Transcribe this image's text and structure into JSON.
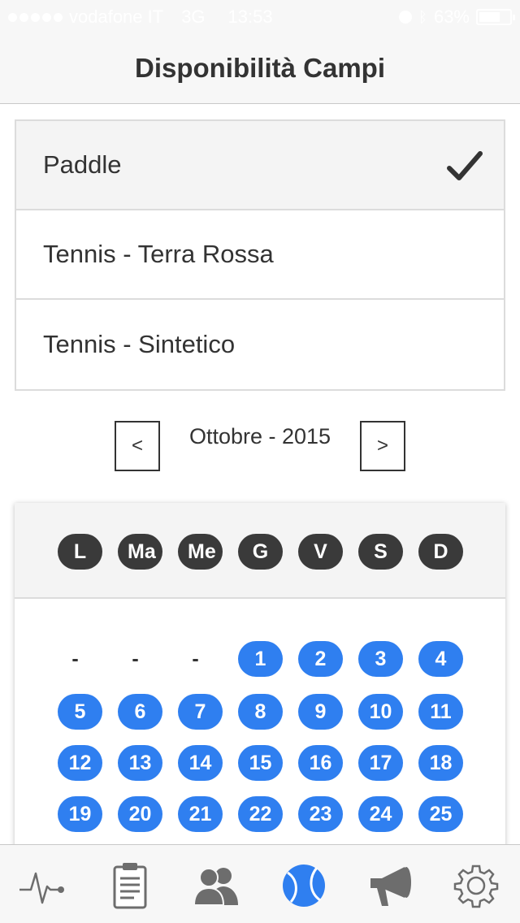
{
  "status_bar": {
    "carrier": "vodafone IT",
    "network": "3G",
    "time": "13:53",
    "battery_percent": "63%",
    "battery_level": 0.63
  },
  "nav": {
    "title": "Disponibilità Campi"
  },
  "sports": {
    "items": [
      {
        "label": "Paddle",
        "selected": true
      },
      {
        "label": "Tennis - Terra Rossa",
        "selected": false
      },
      {
        "label": "Tennis - Sintetico",
        "selected": false
      }
    ]
  },
  "month_nav": {
    "prev_label": "<",
    "next_label": ">",
    "month_label": "Ottobre - 2015"
  },
  "calendar": {
    "weekdays": [
      "L",
      "Ma",
      "Me",
      "G",
      "V",
      "S",
      "D"
    ],
    "rows": [
      [
        "-",
        "-",
        "-",
        "1",
        "2",
        "3",
        "4"
      ],
      [
        "5",
        "6",
        "7",
        "8",
        "9",
        "10",
        "11"
      ],
      [
        "12",
        "13",
        "14",
        "15",
        "16",
        "17",
        "18"
      ],
      [
        "19",
        "20",
        "21",
        "22",
        "23",
        "24",
        "25"
      ]
    ],
    "accent_color": "#2f7ff0",
    "weekday_color": "#3a3a3a"
  },
  "tab_bar": {
    "icons": [
      "activity-icon",
      "clipboard-icon",
      "users-icon",
      "tennis-ball-icon",
      "megaphone-icon",
      "gear-icon"
    ],
    "active_icon": "tennis-ball-icon",
    "active_color": "#2f7ff0"
  }
}
